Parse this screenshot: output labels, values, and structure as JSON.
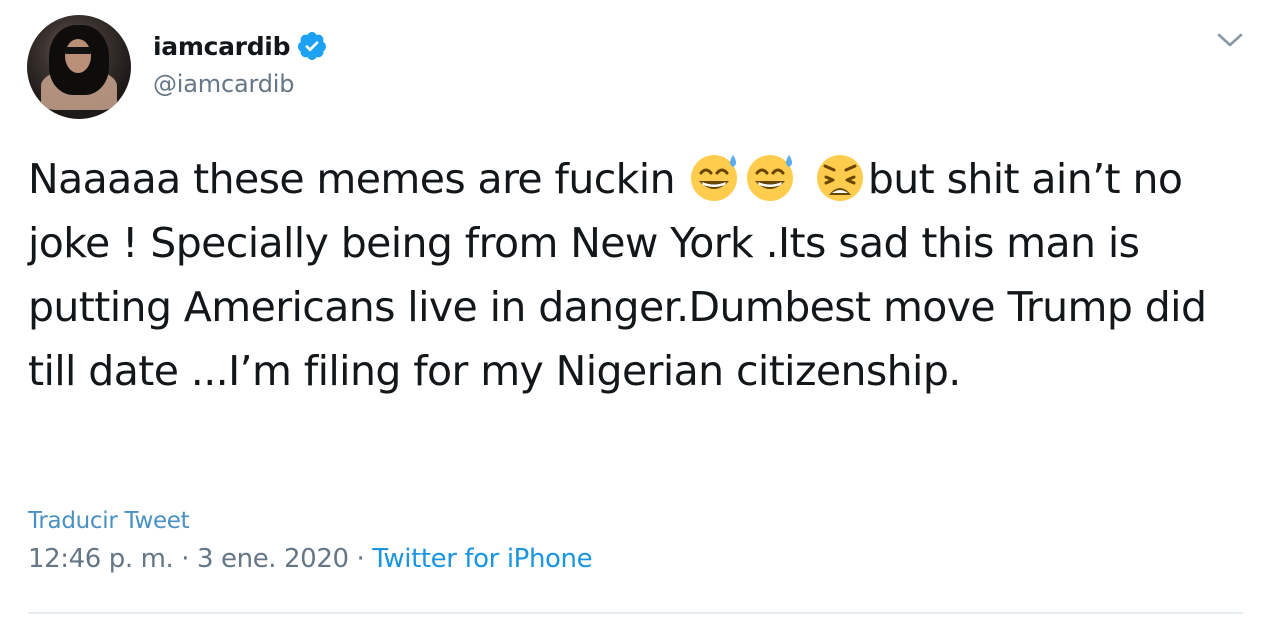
{
  "tweet": {
    "display_name": "iamcardib",
    "handle": "@iamcardib",
    "verified": true,
    "text_part1": "Naaaaa these memes are fuckin ",
    "emojis": [
      "grinning-sweat-emoji",
      "grinning-sweat-emoji",
      "weary-face-emoji"
    ],
    "text_part2": "but shit ain’t no joke ! Specially being from New York .Its sad this man is putting Americans live in danger.Dumbest move Trump did till date ...I’m filing for my Nigerian citizenship.",
    "translate_label": "Traducir Tweet",
    "time": "12:46 p. m.",
    "separator1": " · ",
    "date": "3 ene. 2020",
    "separator2": " · ",
    "source": "Twitter for iPhone"
  },
  "colors": {
    "verified_blue": "#1da1f2",
    "link_blue": "#1b95e0",
    "secondary_text": "#657786",
    "emoji_yellow": "#ffcc4d"
  }
}
